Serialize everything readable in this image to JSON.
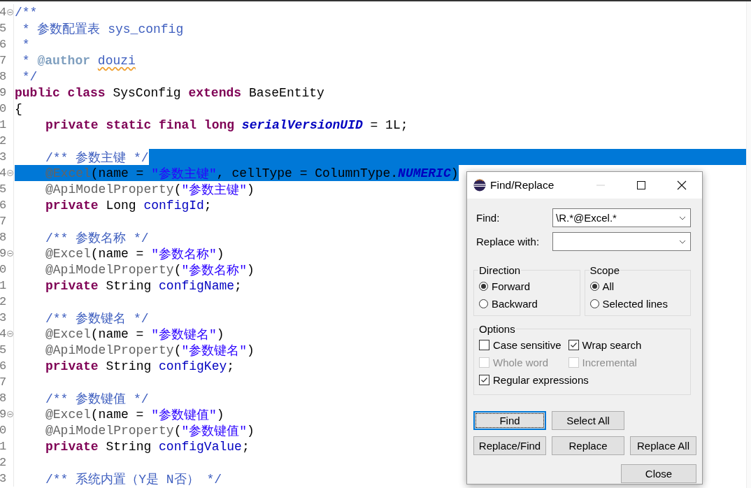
{
  "editor": {
    "lines": [
      {
        "number": "4",
        "fold": true,
        "selected": false,
        "eol_selected": false,
        "indented": false,
        "tokens": [
          {
            "kind": "comment",
            "text": "/**"
          }
        ]
      },
      {
        "number": "5",
        "fold": false,
        "selected": false,
        "eol_selected": false,
        "indented": false,
        "tokens": [
          {
            "kind": "comment",
            "text": " * 参数配置表 sys_config"
          }
        ]
      },
      {
        "number": "6",
        "fold": false,
        "selected": false,
        "eol_selected": false,
        "indented": false,
        "tokens": [
          {
            "kind": "comment",
            "text": " *"
          }
        ]
      },
      {
        "number": "7",
        "fold": false,
        "selected": false,
        "eol_selected": false,
        "indented": false,
        "tokens": [
          {
            "kind": "comment",
            "text": " * "
          },
          {
            "kind": "doctag",
            "text": "@author "
          },
          {
            "kind": "misspelled",
            "text": "douzi"
          }
        ]
      },
      {
        "number": "8",
        "fold": false,
        "selected": false,
        "eol_selected": false,
        "indented": false,
        "tokens": [
          {
            "kind": "comment",
            "text": " */"
          }
        ]
      },
      {
        "number": "9",
        "fold": false,
        "selected": false,
        "eol_selected": false,
        "indented": false,
        "tokens": [
          {
            "kind": "keyword",
            "text": "public class"
          },
          {
            "kind": "plain",
            "text": " SysConfig "
          },
          {
            "kind": "keyword",
            "text": "extends"
          },
          {
            "kind": "plain",
            "text": " BaseEntity"
          }
        ]
      },
      {
        "number": "0",
        "fold": false,
        "selected": false,
        "eol_selected": false,
        "indented": false,
        "tokens": [
          {
            "kind": "plain",
            "text": "{"
          }
        ]
      },
      {
        "number": "1",
        "fold": false,
        "selected": false,
        "eol_selected": false,
        "indented": true,
        "tokens": [
          {
            "kind": "keyword",
            "text": "private static final long "
          },
          {
            "kind": "constant",
            "text": "serialVersionUID"
          },
          {
            "kind": "plain",
            "text": " = 1L;"
          }
        ]
      },
      {
        "number": "2",
        "fold": false,
        "eol_selected": false
      },
      {
        "number": "3",
        "fold": false,
        "selected": false,
        "eol_selected": true,
        "indented": true,
        "tokens": [
          {
            "kind": "comment",
            "text": "/** 参数主键 */"
          }
        ]
      },
      {
        "number": "4",
        "fold": true,
        "selected": true,
        "eol_selected": false,
        "indented": true,
        "tokens": [
          {
            "kind": "annotation",
            "text": "@Excel"
          },
          {
            "kind": "plain",
            "text": "(name = "
          },
          {
            "kind": "string",
            "text": "\"参数主键\""
          },
          {
            "kind": "plain",
            "text": ", cellType = ColumnType."
          },
          {
            "kind": "constant",
            "text": "NUMERIC"
          },
          {
            "kind": "plain",
            "text": ")"
          }
        ]
      },
      {
        "number": "5",
        "fold": false,
        "selected": false,
        "eol_selected": false,
        "indented": true,
        "tokens": [
          {
            "kind": "annotation",
            "text": "@ApiModelProperty"
          },
          {
            "kind": "plain",
            "text": "("
          },
          {
            "kind": "string",
            "text": "\"参数主键\""
          },
          {
            "kind": "plain",
            "text": ")"
          }
        ]
      },
      {
        "number": "6",
        "fold": false,
        "selected": false,
        "eol_selected": false,
        "indented": true,
        "tokens": [
          {
            "kind": "keyword",
            "text": "private"
          },
          {
            "kind": "plain",
            "text": " Long "
          },
          {
            "kind": "field",
            "text": "configId"
          },
          {
            "kind": "plain",
            "text": ";"
          }
        ]
      },
      {
        "number": "7",
        "fold": false,
        "eol_selected": false
      },
      {
        "number": "8",
        "fold": false,
        "selected": false,
        "eol_selected": false,
        "indented": true,
        "tokens": [
          {
            "kind": "comment",
            "text": "/** 参数名称 */"
          }
        ]
      },
      {
        "number": "9",
        "fold": true,
        "selected": false,
        "eol_selected": false,
        "indented": true,
        "tokens": [
          {
            "kind": "annotation",
            "text": "@Excel"
          },
          {
            "kind": "plain",
            "text": "(name = "
          },
          {
            "kind": "string",
            "text": "\"参数名称\""
          },
          {
            "kind": "plain",
            "text": ")"
          }
        ]
      },
      {
        "number": "0",
        "fold": false,
        "selected": false,
        "eol_selected": false,
        "indented": true,
        "tokens": [
          {
            "kind": "annotation",
            "text": "@ApiModelProperty"
          },
          {
            "kind": "plain",
            "text": "("
          },
          {
            "kind": "string",
            "text": "\"参数名称\""
          },
          {
            "kind": "plain",
            "text": ")"
          }
        ]
      },
      {
        "number": "1",
        "fold": false,
        "selected": false,
        "eol_selected": false,
        "indented": true,
        "tokens": [
          {
            "kind": "keyword",
            "text": "private"
          },
          {
            "kind": "plain",
            "text": " String "
          },
          {
            "kind": "field",
            "text": "configName"
          },
          {
            "kind": "plain",
            "text": ";"
          }
        ]
      },
      {
        "number": "2",
        "fold": false,
        "eol_selected": false
      },
      {
        "number": "3",
        "fold": false,
        "selected": false,
        "eol_selected": false,
        "indented": true,
        "tokens": [
          {
            "kind": "comment",
            "text": "/** 参数键名 */"
          }
        ]
      },
      {
        "number": "4",
        "fold": true,
        "selected": false,
        "eol_selected": false,
        "indented": true,
        "tokens": [
          {
            "kind": "annotation",
            "text": "@Excel"
          },
          {
            "kind": "plain",
            "text": "(name = "
          },
          {
            "kind": "string",
            "text": "\"参数键名\""
          },
          {
            "kind": "plain",
            "text": ")"
          }
        ]
      },
      {
        "number": "5",
        "fold": false,
        "selected": false,
        "eol_selected": false,
        "indented": true,
        "tokens": [
          {
            "kind": "annotation",
            "text": "@ApiModelProperty"
          },
          {
            "kind": "plain",
            "text": "("
          },
          {
            "kind": "string",
            "text": "\"参数键名\""
          },
          {
            "kind": "plain",
            "text": ")"
          }
        ]
      },
      {
        "number": "6",
        "fold": false,
        "selected": false,
        "eol_selected": false,
        "indented": true,
        "tokens": [
          {
            "kind": "keyword",
            "text": "private"
          },
          {
            "kind": "plain",
            "text": " String "
          },
          {
            "kind": "field",
            "text": "configKey"
          },
          {
            "kind": "plain",
            "text": ";"
          }
        ]
      },
      {
        "number": "7",
        "fold": false,
        "eol_selected": false
      },
      {
        "number": "8",
        "fold": false,
        "selected": false,
        "eol_selected": false,
        "indented": true,
        "tokens": [
          {
            "kind": "comment",
            "text": "/** 参数键值 */"
          }
        ]
      },
      {
        "number": "9",
        "fold": true,
        "selected": false,
        "eol_selected": false,
        "indented": true,
        "tokens": [
          {
            "kind": "annotation",
            "text": "@Excel"
          },
          {
            "kind": "plain",
            "text": "(name = "
          },
          {
            "kind": "string",
            "text": "\"参数键值\""
          },
          {
            "kind": "plain",
            "text": ")"
          }
        ]
      },
      {
        "number": "0",
        "fold": false,
        "selected": false,
        "eol_selected": false,
        "indented": true,
        "tokens": [
          {
            "kind": "annotation",
            "text": "@ApiModelProperty"
          },
          {
            "kind": "plain",
            "text": "("
          },
          {
            "kind": "string",
            "text": "\"参数键值\""
          },
          {
            "kind": "plain",
            "text": ")"
          }
        ]
      },
      {
        "number": "1",
        "fold": false,
        "selected": false,
        "eol_selected": false,
        "indented": true,
        "tokens": [
          {
            "kind": "keyword",
            "text": "private"
          },
          {
            "kind": "plain",
            "text": " String "
          },
          {
            "kind": "field",
            "text": "configValue"
          },
          {
            "kind": "plain",
            "text": ";"
          }
        ]
      },
      {
        "number": "2",
        "fold": false,
        "eol_selected": false
      },
      {
        "number": "3",
        "fold": false,
        "selected": false,
        "eol_selected": false,
        "indented": true,
        "tokens": [
          {
            "kind": "comment",
            "text": "/** 系统内置（Y是 N否） */"
          }
        ]
      }
    ]
  },
  "dialog": {
    "title": "Find/Replace",
    "fields": [
      {
        "label": "Find:",
        "value": "\\R.*@Excel.*"
      },
      {
        "label": "Replace with:"
      }
    ],
    "groups": [
      {
        "title": "Direction",
        "options": [
          {
            "label": "Forward",
            "selected": true
          },
          {
            "label": "Backward",
            "selected": false
          }
        ]
      },
      {
        "title": "Scope",
        "options": [
          {
            "label": "All",
            "selected": true
          },
          {
            "label": "Selected lines",
            "selected": false
          }
        ]
      }
    ],
    "options": {
      "title": "Options",
      "items": [
        {
          "label": "Case sensitive",
          "checked": false,
          "disabled": false
        },
        {
          "label": "Wrap search",
          "checked": true,
          "disabled": false
        },
        {
          "label": "Whole word",
          "checked": false,
          "disabled": true
        },
        {
          "label": "Incremental",
          "checked": false,
          "disabled": true
        },
        {
          "label": "Regular expressions",
          "checked": true,
          "disabled": false
        }
      ]
    },
    "button_rows": [
      {
        "right_aligned": false,
        "buttons": [
          {
            "label": "Find",
            "default": true
          },
          {
            "label": "Select All",
            "default": false
          }
        ]
      },
      {
        "right_aligned": false,
        "buttons": [
          {
            "label": "Replace/Find",
            "default": false
          },
          {
            "label": "Replace",
            "default": false
          },
          {
            "label": "Replace All",
            "default": false
          }
        ]
      },
      {
        "right_aligned": true,
        "buttons": [
          {
            "label": "Close",
            "default": false
          }
        ]
      }
    ]
  }
}
